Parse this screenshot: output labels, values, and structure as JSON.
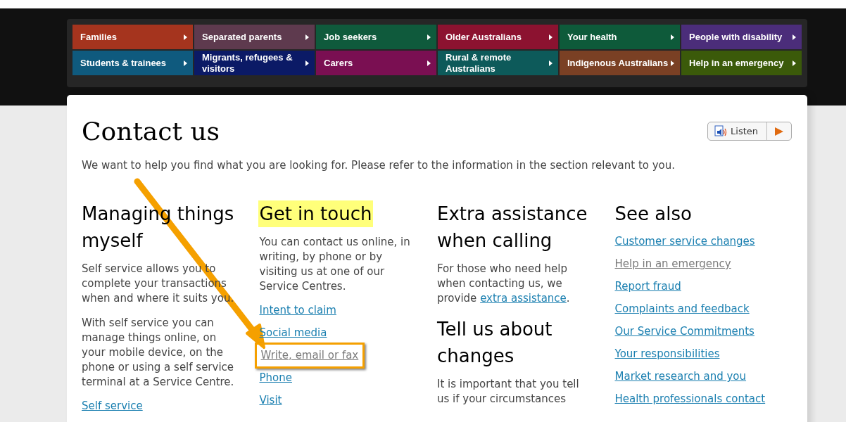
{
  "nav": [
    {
      "label": "Families",
      "color": "#a5341e"
    },
    {
      "label": "Separated parents",
      "color": "#5e3a4e"
    },
    {
      "label": "Job seekers",
      "color": "#0f5a3c"
    },
    {
      "label": "Older Australians",
      "color": "#8c1230"
    },
    {
      "label": "Your health",
      "color": "#0e5a3a"
    },
    {
      "label": "People with disability",
      "color": "#4b2d7a"
    },
    {
      "label": "Students & trainees",
      "color": "#0f5a7e"
    },
    {
      "label": "Migrants, refugees & visitors",
      "color": "#0b1a66"
    },
    {
      "label": "Carers",
      "color": "#7a0f52"
    },
    {
      "label": "Rural & remote Australians",
      "color": "#0d5a5a"
    },
    {
      "label": "Indigenous Australians",
      "color": "#7a4024"
    },
    {
      "label": "Help in an emergency",
      "color": "#3b5a0a"
    }
  ],
  "page": {
    "title": "Contact us",
    "listen": "Listen",
    "intro": "We want to help you find what you are looking for. Please refer to the information in the section relevant to you."
  },
  "columns": [
    {
      "sections": [
        {
          "heading": "Managing things myself",
          "highlighted": false,
          "blocks": [
            {
              "kind": "text",
              "text": "Self service allows you to complete your transactions when and where it suits you."
            },
            {
              "kind": "text",
              "text": "With self service you can manage things online, on your mobile device, on the phone or using a self service terminal at a Service Centre."
            },
            {
              "kind": "link",
              "text": "Self service",
              "visited": false,
              "annotated": false
            }
          ]
        }
      ]
    },
    {
      "sections": [
        {
          "heading": "Get in touch",
          "highlighted": true,
          "blocks": [
            {
              "kind": "text",
              "text": "You can contact us online, in writing, by phone or by visiting us at one of our Service Centres."
            },
            {
              "kind": "link",
              "text": "Intent to claim",
              "visited": false,
              "annotated": false
            },
            {
              "kind": "link",
              "text": "Social media",
              "visited": false,
              "annotated": false
            },
            {
              "kind": "link",
              "text": "Write, email or fax",
              "visited": true,
              "annotated": true
            },
            {
              "kind": "link",
              "text": "Phone",
              "visited": false,
              "annotated": false
            },
            {
              "kind": "link",
              "text": "Visit",
              "visited": false,
              "annotated": false
            }
          ]
        }
      ]
    },
    {
      "sections": [
        {
          "heading": "Extra assistance when calling",
          "highlighted": false,
          "blocks": [
            {
              "kind": "textlink",
              "text": "For those who need help when contacting us, we provide",
              "link": "extra assistance",
              "after": "."
            }
          ]
        },
        {
          "heading": "Tell us about changes",
          "highlighted": false,
          "blocks": [
            {
              "kind": "text",
              "text": "It is important that you tell us if your circumstances"
            }
          ]
        }
      ]
    },
    {
      "sections": [
        {
          "heading": "See also",
          "highlighted": false,
          "blocks": [
            {
              "kind": "link",
              "text": "Customer service changes",
              "visited": false,
              "annotated": false
            },
            {
              "kind": "link",
              "text": "Help in an emergency",
              "visited": true,
              "annotated": false
            },
            {
              "kind": "link",
              "text": "Report fraud",
              "visited": false,
              "annotated": false
            },
            {
              "kind": "link",
              "text": "Complaints and feedback",
              "visited": false,
              "annotated": false
            },
            {
              "kind": "link",
              "text": "Our Service Commitments",
              "visited": false,
              "annotated": false
            },
            {
              "kind": "link",
              "text": "Your responsibilities",
              "visited": false,
              "annotated": false
            },
            {
              "kind": "link",
              "text": "Market research and you",
              "visited": false,
              "annotated": false
            },
            {
              "kind": "link",
              "text": "Health professionals contact",
              "visited": false,
              "annotated": false
            }
          ]
        }
      ]
    }
  ]
}
